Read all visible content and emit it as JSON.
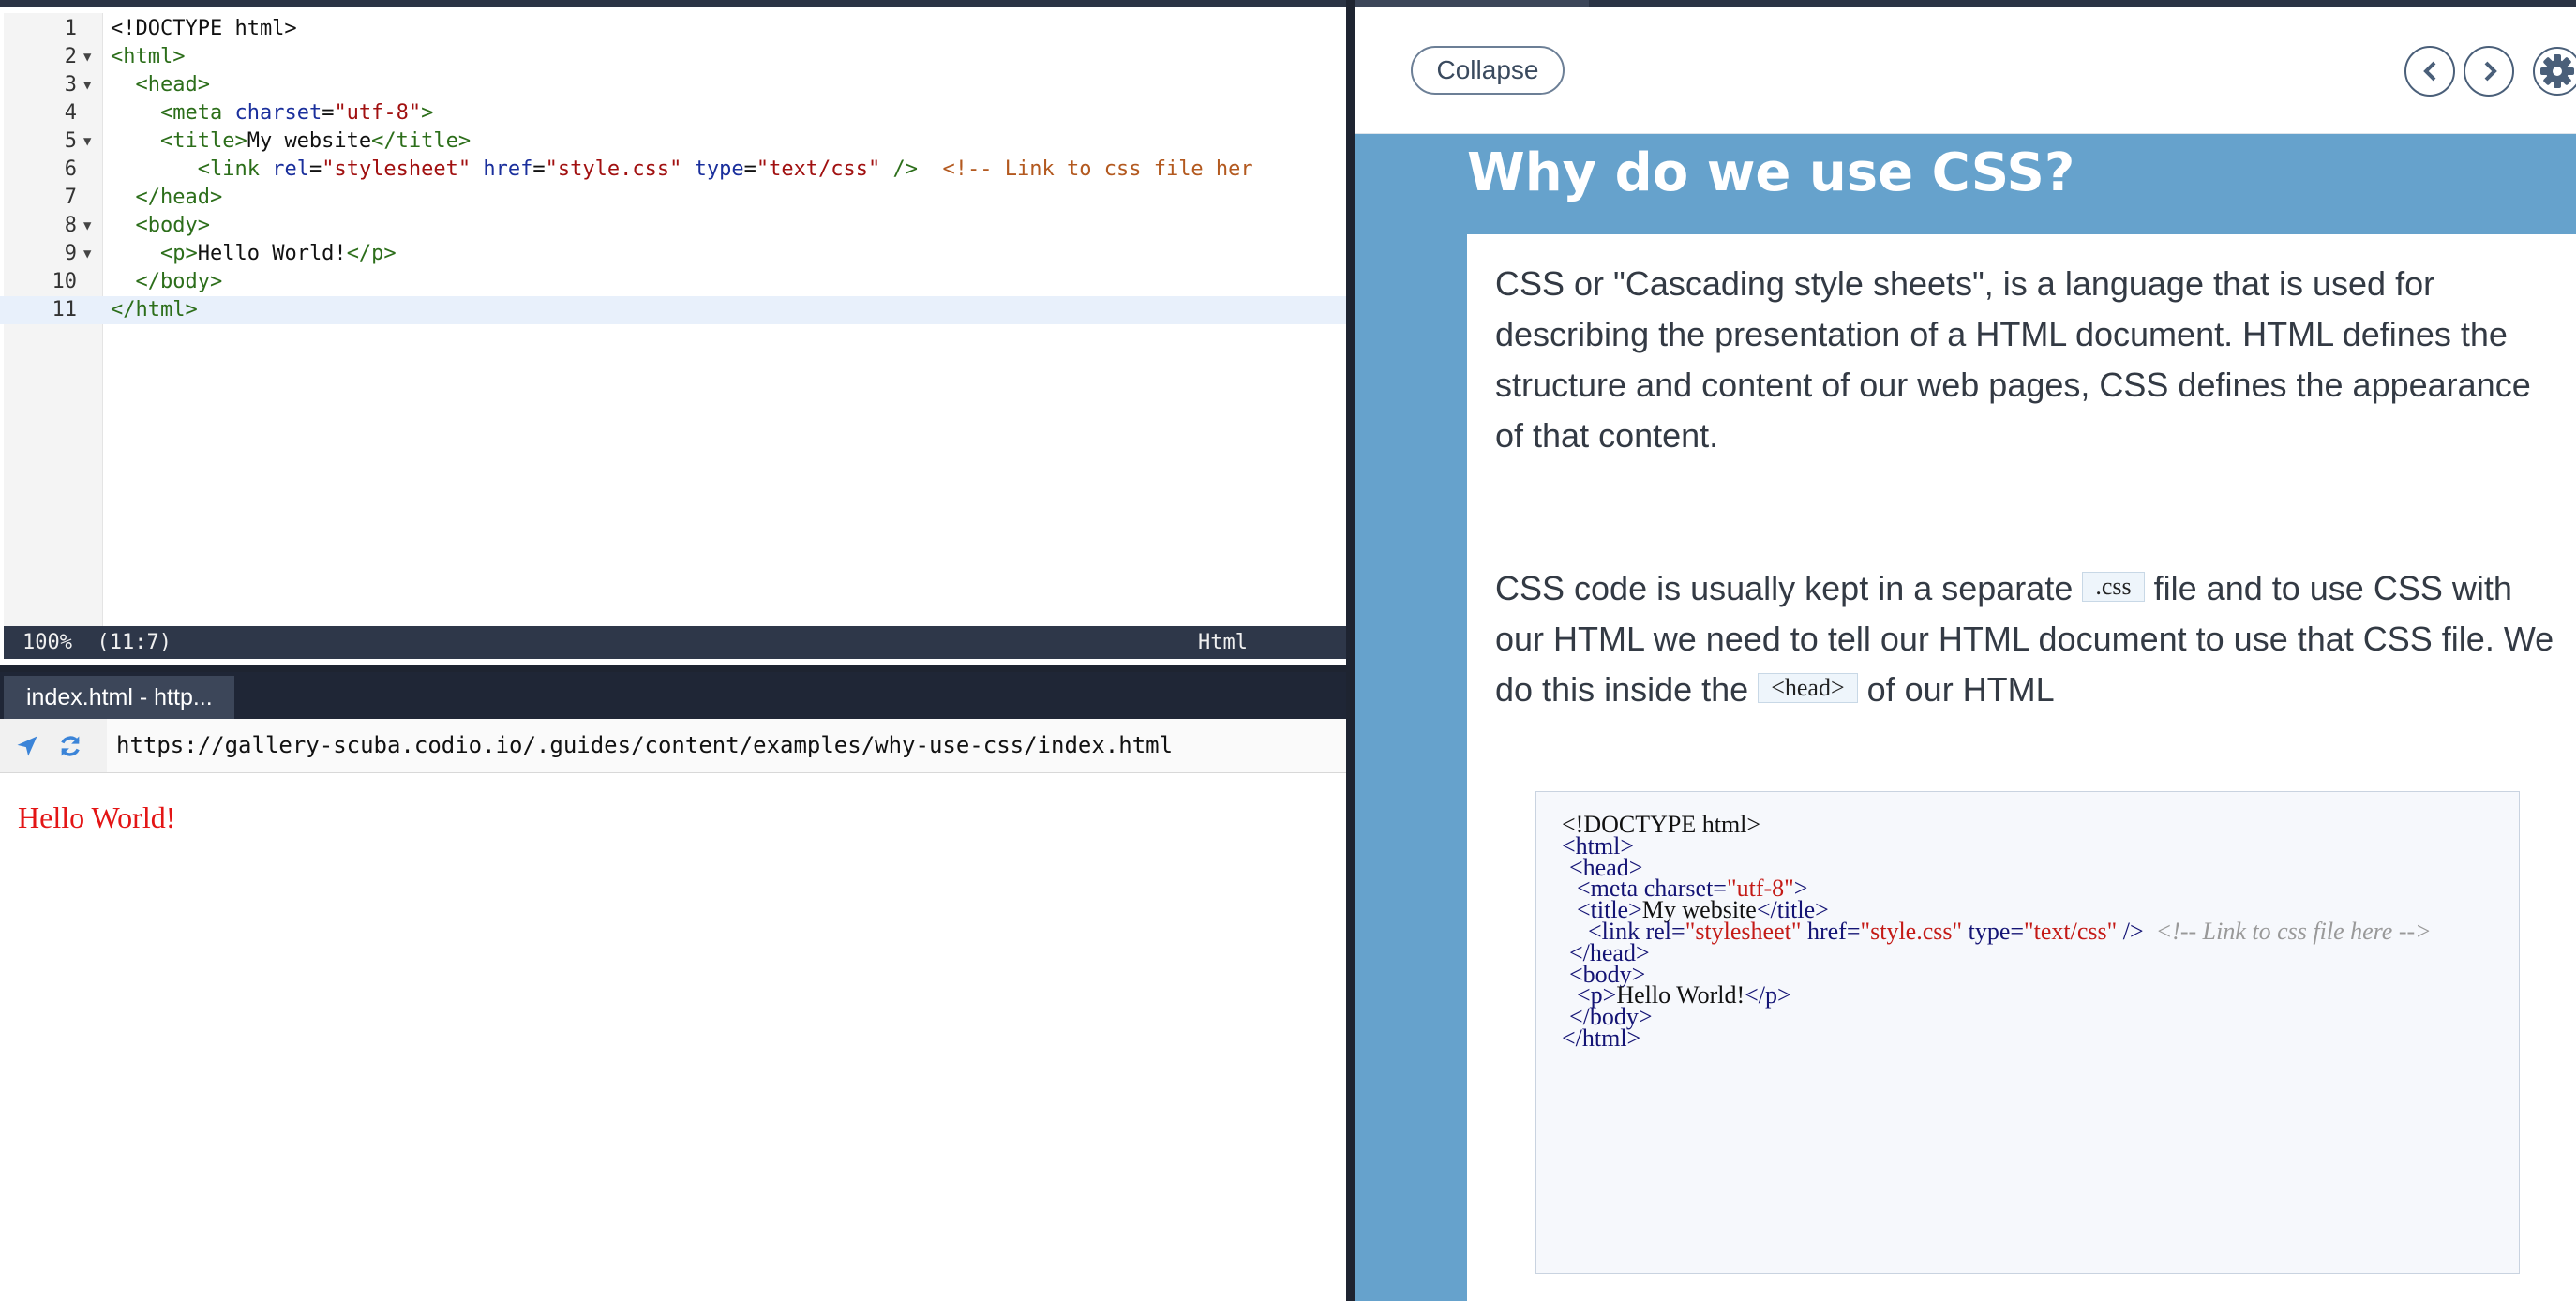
{
  "editor": {
    "lines": [
      {
        "n": "1",
        "fold": false,
        "html": "&lt;!DOCTYPE html&gt;"
      },
      {
        "n": "2",
        "fold": true,
        "html": "<span class='tg'>&lt;html&gt;</span>"
      },
      {
        "n": "3",
        "fold": true,
        "html": "  <span class='tg'>&lt;head&gt;</span>"
      },
      {
        "n": "4",
        "fold": false,
        "html": "    <span class='tg'>&lt;meta</span> <span class='at'>charset</span>=<span class='st'>\"utf-8\"</span><span class='tg'>&gt;</span>"
      },
      {
        "n": "5",
        "fold": true,
        "html": "    <span class='tg'>&lt;title&gt;</span>My website<span class='tg'>&lt;/title&gt;</span>"
      },
      {
        "n": "6",
        "fold": false,
        "html": "       <span class='tg'>&lt;link</span> <span class='at'>rel</span>=<span class='st'>\"stylesheet\"</span> <span class='at'>href</span>=<span class='st'>\"style.css\"</span> <span class='at'>type</span>=<span class='st'>\"text/css\"</span> <span class='tg'>/&gt;</span>  <span class='cm'>&lt;!-- Link to css file her</span>"
      },
      {
        "n": "7",
        "fold": false,
        "html": "  <span class='tg'>&lt;/head&gt;</span>"
      },
      {
        "n": "8",
        "fold": true,
        "html": "  <span class='tg'>&lt;body&gt;</span>"
      },
      {
        "n": "9",
        "fold": true,
        "html": "    <span class='tg'>&lt;p&gt;</span>Hello World!<span class='tg'>&lt;/p&gt;</span>"
      },
      {
        "n": "10",
        "fold": false,
        "html": "  <span class='tg'>&lt;/body&gt;</span>"
      },
      {
        "n": "11",
        "fold": false,
        "html": "<span class='tg'>&lt;/html&gt;</span>"
      }
    ],
    "active_line": 11,
    "status_left": "100%  (11:7)",
    "status_mode": "Html"
  },
  "preview": {
    "tab_label": "index.html - http...",
    "url": "https://gallery-scuba.codio.io/.guides/content/examples/why-use-css/index.html",
    "page_text": "Hello World!",
    "page_text_color": "#e31515"
  },
  "guide": {
    "collapse_label": "Collapse",
    "title": "Why do we use CSS?",
    "para1": "CSS or \"Cascading style sheets\", is a language that is used for describing the presentation of a HTML document. HTML defines the structure and content of our web pages, CSS defines the appearance of that content.",
    "para2_a": "CSS code is usually kept in a separate",
    "para2_chip1": ".css",
    "para2_b": "file and to use CSS with our HTML we need to tell our HTML document to use that CSS file. We do this inside the",
    "para2_chip2": "<head>",
    "para2_c": "of our HTML",
    "code_lines": [
      {
        "html": "&lt;!DOCTYPE html&gt;"
      },
      {
        "html": "<span class='k'>&lt;html&gt;</span>"
      },
      {
        "html": "<span class='k'>&lt;head&gt;</span>"
      },
      {
        "html": "<span class='k'>&lt;meta charset=</span><span class='s'>\"utf-8\"</span><span class='k'>&gt;</span>"
      },
      {
        "html": "<span class='k'>&lt;title&gt;</span>My website<span class='k'>&lt;/title&gt;</span>"
      },
      {
        "html": "<span class='k'>&lt;link rel=</span><span class='s'>\"stylesheet\"</span> <span class='k'>href=</span><span class='s'>\"style.css\"</span> <span class='k'>type=</span><span class='s'>\"text/css\"</span> <span class='k'>/&gt;</span>  <span class='c'>&lt;!-- Link to css file here --&gt;</span>"
      },
      {
        "html": "<span class='k'>&lt;/head&gt;</span>"
      },
      {
        "html": "<span class='k'>&lt;body&gt;</span>"
      },
      {
        "html": "<span class='k'>&lt;p&gt;</span>Hello World!<span class='k'>&lt;/p&gt;</span>"
      },
      {
        "html": "<span class='k'>&lt;/body&gt;</span>"
      },
      {
        "html": "<span class='k'>&lt;/html&gt;</span>"
      }
    ]
  },
  "colors": {
    "guide_bg": "#66a2cc",
    "dark_chrome": "#1e2431",
    "accent_blue": "#3b84d8"
  },
  "icons": [
    "fold-arrow-icon",
    "navigate-icon",
    "refresh-icon",
    "chevron-left-icon",
    "chevron-right-icon",
    "gear-icon"
  ]
}
